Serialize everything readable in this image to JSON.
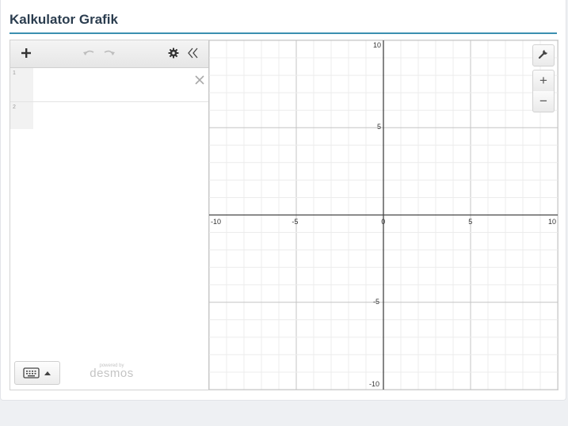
{
  "page": {
    "title": "Kalkulator Grafik"
  },
  "toolbar": {
    "add_icon": "plus-icon",
    "undo_icon": "undo-icon",
    "redo_icon": "redo-icon",
    "settings_icon": "gear-icon",
    "collapse_icon": "double-chevron-left-icon"
  },
  "expressions": [
    {
      "index": "1",
      "value": ""
    },
    {
      "index": "2",
      "value": ""
    }
  ],
  "keyboard": {
    "icon": "keyboard-icon",
    "caret": "caret-up-icon"
  },
  "branding": {
    "powered_by": "powered by",
    "brand": "desmos"
  },
  "graph_controls": {
    "settings_icon": "wrench-icon",
    "zoom_in_label": "+",
    "zoom_out_label": "−"
  },
  "axes": {
    "x_range": [
      -10,
      10
    ],
    "y_range": [
      -10,
      10
    ],
    "x_tick_labels": [
      "-10",
      "-5",
      "0",
      "5",
      "10"
    ],
    "y_tick_labels": [
      "10",
      "5",
      "-5",
      "-10"
    ],
    "major_step": 5,
    "minor_step": 1,
    "grid": true
  },
  "colors": {
    "accent": "#3b8fb0",
    "title": "#2b3d4f",
    "minor_grid": "#ececec",
    "major_grid": "#c4c4c4",
    "axis": "#444444"
  }
}
